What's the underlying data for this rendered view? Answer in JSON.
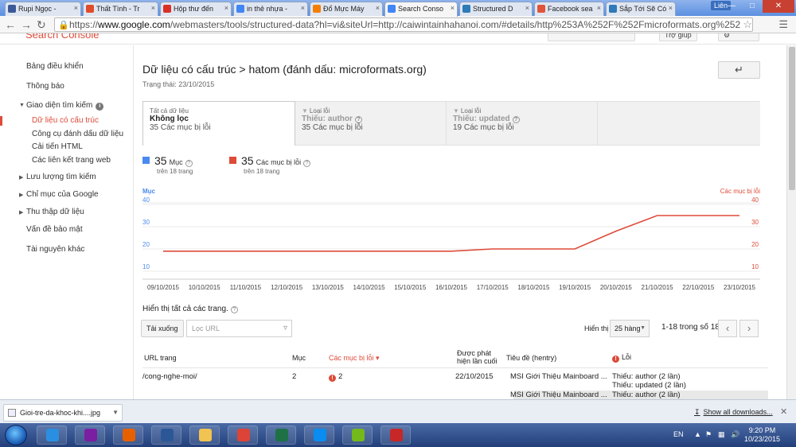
{
  "browser": {
    "tabs": [
      {
        "label": "Rupi Ngọc -",
        "color": "#3b5998"
      },
      {
        "label": "Thất Tình - Tr",
        "color": "#e04c2a"
      },
      {
        "label": "Hộp thư đến",
        "color": "#d93025"
      },
      {
        "label": "in thẻ nhựa -",
        "color": "#4285f4"
      },
      {
        "label": "Đổ Mực Máy",
        "color": "#f57d00"
      },
      {
        "label": "Search Conso",
        "color": "#4285f4"
      },
      {
        "label": "Structured D",
        "color": "#2f7ab8"
      },
      {
        "label": "Facebook sea",
        "color": "#e0553a"
      },
      {
        "label": "Sắp Tới Sẽ Có",
        "color": "#2f7ab8"
      }
    ],
    "active_tab_index": 5,
    "user_label": "Liên",
    "url_host": "www.google.com",
    "url_rest": "/webmasters/tools/structured-data?hl=vi&siteUrl=http://caiwintainhahanoi.com/#details/http%253A%252F%252Fmicroformats.org%252"
  },
  "app": {
    "logo": "Search Console",
    "help_label": "Trợ giúp"
  },
  "sidebar": {
    "items": [
      {
        "label": "Bảng điều khiển"
      },
      {
        "label": "Thông báo"
      },
      {
        "label": "Giao diện tìm kiếm"
      },
      {
        "label": "Dữ liệu có cấu trúc"
      },
      {
        "label": "Công cụ đánh dấu dữ liệu"
      },
      {
        "label": "Cải tiến HTML"
      },
      {
        "label": "Các liên kết trang web"
      },
      {
        "label": "Lưu lượng tìm kiếm"
      },
      {
        "label": "Chỉ mục của Google"
      },
      {
        "label": "Thu thập dữ liệu"
      },
      {
        "label": "Vấn đề bảo mật"
      },
      {
        "label": "Tài nguyên khác"
      }
    ]
  },
  "main": {
    "title": "Dữ liệu có cấu trúc > hatom (đánh dấu: microformats.org)",
    "status": "Trạng thái: 23/10/2015",
    "back_icon": "back-arrow-icon",
    "filter_tabs": [
      {
        "line1": "Tất cả dữ liệu",
        "line2": "Không lọc",
        "line3": "35 Các mục bị lỗi"
      },
      {
        "line1": "Loại lỗi",
        "line2": "Thiếu: author",
        "line3": "35 Các mục bị lỗi"
      },
      {
        "line1": "Loại lỗi",
        "line2": "Thiếu: updated",
        "line3": "19 Các mục bị lỗi"
      }
    ],
    "metrics": [
      {
        "value": "35",
        "label": "Mục",
        "sub": "trên 18 trang",
        "color": "#4a89f0"
      },
      {
        "value": "35",
        "label": "Các mục bị lỗi",
        "sub": "trên 18 trang",
        "color": "#dd4b39"
      }
    ],
    "show_all": "Hiển thị tất cả các trang.",
    "download_label": "Tải xuống",
    "url_filter_placeholder": "Lọc URL",
    "show_label": "Hiển thị",
    "page_size": "25 hàng",
    "range_label": "1-18 trong số 18",
    "table": {
      "headers": {
        "url": "URL trang",
        "items": "Mục",
        "error_items": "Các mục bị lỗi",
        "detected_1": "Được phát",
        "detected_2": "hiện lần cuối",
        "title": "Tiêu đề (hentry)",
        "errors": "Lỗi"
      },
      "rows": [
        {
          "url": "/cong-nghe-moi/",
          "items": "2",
          "error_items": "2",
          "date": "22/10/2015",
          "title": "MSI Giới Thiệu Mainboard ...",
          "errors1": "Thiếu: author (2 lần)",
          "errors2": "Thiếu: updated (2 lần)"
        },
        {
          "url": "",
          "items": "",
          "error_items": "",
          "date": "",
          "title": "MSI Giới Thiệu Mainboard ...",
          "errors1": "Thiếu: author (2 lần)",
          "errors2": ""
        }
      ]
    }
  },
  "chart_data": {
    "type": "line",
    "title": "",
    "left_axis_label": "Mục",
    "right_axis_label": "Các mục bị lỗi",
    "ylim": [
      10,
      40
    ],
    "y_ticks": [
      10,
      20,
      30,
      40
    ],
    "x": [
      "09/10/2015",
      "10/10/2015",
      "11/10/2015",
      "12/10/2015",
      "13/10/2015",
      "14/10/2015",
      "15/10/2015",
      "16/10/2015",
      "17/10/2015",
      "18/10/2015",
      "19/10/2015",
      "20/10/2015",
      "21/10/2015",
      "22/10/2015",
      "23/10/2015"
    ],
    "series": [
      {
        "name": "Các mục bị lỗi",
        "color": "#dd4b39",
        "values": [
          19,
          19,
          19,
          19,
          19,
          19,
          19,
          19,
          20,
          20,
          20,
          28,
          35,
          35,
          35
        ]
      }
    ],
    "grid": true
  },
  "downloads": {
    "file": "Gioi-tre-da-khoc-khi....jpg",
    "show_all": "Show all downloads..."
  },
  "taskbar": {
    "lang": "EN",
    "time": "9:20 PM",
    "date": "10/23/2015",
    "apps": [
      {
        "name": "internet-explorer-icon",
        "color": "#2a8fe0"
      },
      {
        "name": "yahoo-messenger-icon",
        "color": "#7b1fa2"
      },
      {
        "name": "firefox-icon",
        "color": "#e66000"
      },
      {
        "name": "word-icon",
        "color": "#2b5797"
      },
      {
        "name": "folder-icon",
        "color": "#f2c350"
      },
      {
        "name": "chrome-icon",
        "color": "#db4437"
      },
      {
        "name": "excel-icon",
        "color": "#1e7145"
      },
      {
        "name": "zalo-icon",
        "color": "#0a8cf0"
      },
      {
        "name": "coccoc-icon",
        "color": "#74b81c"
      },
      {
        "name": "app-icon",
        "color": "#c62828"
      }
    ]
  }
}
